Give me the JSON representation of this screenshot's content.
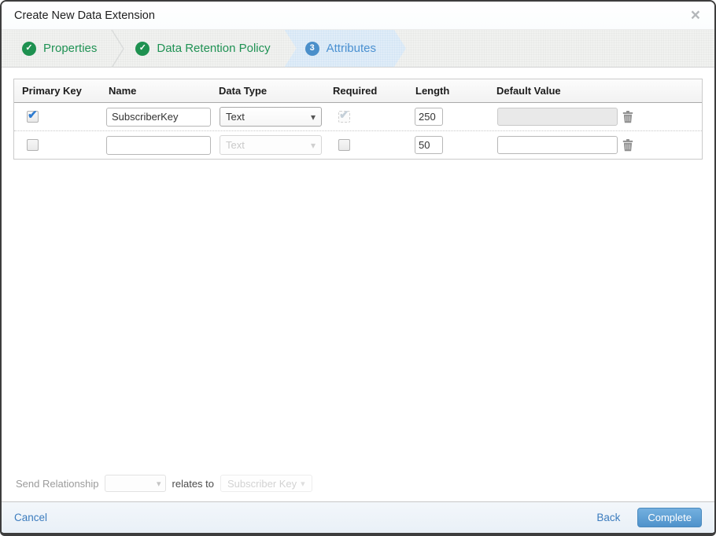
{
  "modal": {
    "title": "Create New Data Extension"
  },
  "icons": {
    "close": "×",
    "check": "✓",
    "caret": "▾"
  },
  "wizard": {
    "steps": [
      {
        "label": "Properties",
        "status": "complete"
      },
      {
        "label": "Data Retention Policy",
        "status": "complete"
      },
      {
        "label": "Attributes",
        "status": "active",
        "number": "3"
      }
    ]
  },
  "table": {
    "headers": [
      "Primary Key",
      "Name",
      "Data Type",
      "Required",
      "Length",
      "Default Value"
    ],
    "rows": [
      {
        "primary_key": true,
        "name": "SubscriberKey",
        "data_type": "Text",
        "required": true,
        "length": "250",
        "default_value": ""
      },
      {
        "primary_key": false,
        "name": "",
        "data_type": "Text",
        "required": false,
        "length": "50",
        "default_value": ""
      }
    ]
  },
  "send_relationship": {
    "label": "Send Relationship",
    "relates_to_label": "relates to",
    "target_field": "Subscriber Key"
  },
  "footer": {
    "cancel_label": "Cancel",
    "back_label": "Back",
    "complete_label": "Complete"
  },
  "colors": {
    "success_green": "#1e9150",
    "accent_blue": "#4a90d1",
    "active_step_bg": "#e0edf8",
    "button_blue": "#4e92cb",
    "checkbox_blue": "#2e7bd0"
  }
}
